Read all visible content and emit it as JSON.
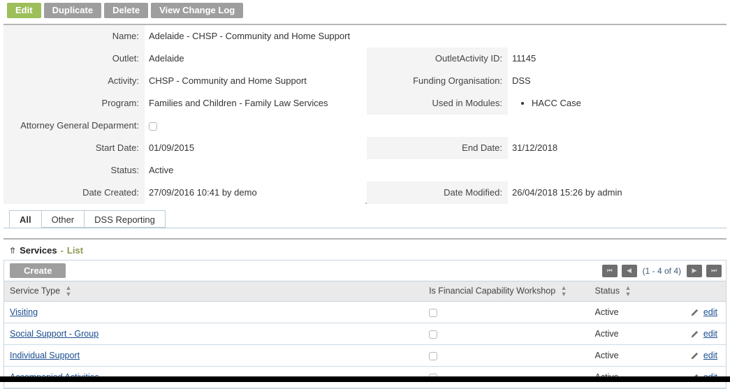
{
  "toolbar": {
    "buttons": [
      {
        "label": "Edit",
        "primary": true
      },
      {
        "label": "Duplicate",
        "primary": false
      },
      {
        "label": "Delete",
        "primary": false
      },
      {
        "label": "View Change Log",
        "primary": false
      }
    ]
  },
  "detail": {
    "left": [
      {
        "label": "Name:",
        "value": "Adelaide - CHSP - Community and Home Support"
      },
      {
        "label": "Outlet:",
        "value": "Adelaide"
      },
      {
        "label": "Activity:",
        "value": "CHSP - Community and Home Support"
      },
      {
        "label": "Program:",
        "value": "Families and Children - Family Law Services"
      },
      {
        "label": "Attorney General Deparment:",
        "value": ""
      },
      {
        "label": "Start Date:",
        "value": "01/09/2015"
      },
      {
        "label": "Status:",
        "value": "Active"
      },
      {
        "label": "Date Created:",
        "value": "27/09/2016 10:41 by demo"
      }
    ],
    "right": [
      {
        "label": "OutletActivity ID:",
        "value": "11145"
      },
      {
        "label": "Funding Organisation:",
        "value": "DSS"
      },
      {
        "label": "Used in Modules:",
        "value": ""
      },
      {
        "label": "End Date:",
        "value": "31/12/2018"
      },
      {
        "label": "Date Modified:",
        "value": "26/04/2018 15:26 by admin"
      }
    ],
    "used_in_modules": [
      "HACC Case"
    ],
    "attorney_general_checked": false
  },
  "tabs": [
    {
      "label": "All",
      "active": true
    },
    {
      "label": "Other",
      "active": false
    },
    {
      "label": "DSS Reporting",
      "active": false
    }
  ],
  "section": {
    "title": "Services",
    "dash": "-",
    "subtitle": "List",
    "collapse_icon": "chevron-up-double"
  },
  "list": {
    "create_label": "Create",
    "pager": {
      "first": "⏮",
      "prev": "◀",
      "label": "(1 - 4 of 4)",
      "next": "▶",
      "last": "⏭"
    },
    "columns": [
      "Service Type",
      "Is Financial Capability Workshop",
      "Status",
      ""
    ],
    "rows": [
      {
        "service_type": "Visiting",
        "is_fcw": false,
        "status": "Active",
        "edit": "edit"
      },
      {
        "service_type": "Social Support - Group",
        "is_fcw": false,
        "status": "Active",
        "edit": "edit"
      },
      {
        "service_type": "Individual Support",
        "is_fcw": false,
        "status": "Active",
        "edit": "edit"
      },
      {
        "service_type": "Accompanied Activities",
        "is_fcw": false,
        "status": "Active",
        "edit": "edit"
      }
    ]
  },
  "colors": {
    "primary_button": "#9cbf5a",
    "secondary_button": "#9e9e9e",
    "link": "#1a4d8f",
    "label_bg": "#f4f4f4"
  }
}
